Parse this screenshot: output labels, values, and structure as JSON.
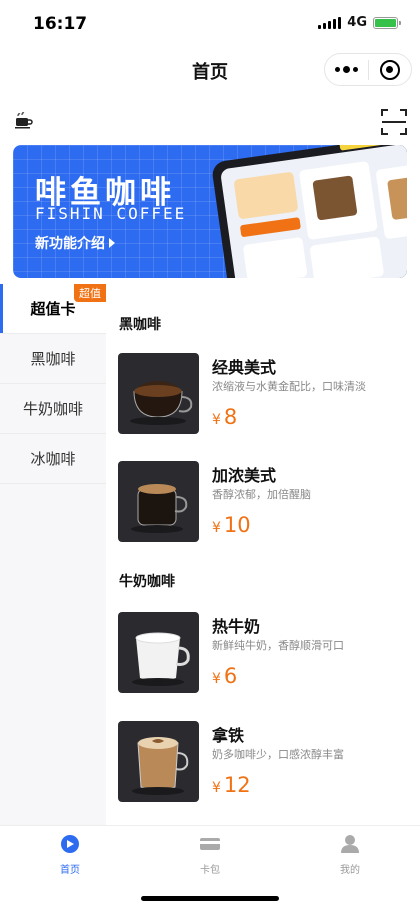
{
  "status": {
    "time": "16:17",
    "network": "4G"
  },
  "nav": {
    "title": "首页"
  },
  "banner": {
    "title_cn": "啡鱼咖啡",
    "title_en": "FISHIN COFFEE",
    "link": "新功能介绍"
  },
  "sidebar": {
    "items": [
      {
        "label": "超值卡",
        "badge": "超值"
      },
      {
        "label": "黑咖啡"
      },
      {
        "label": "牛奶咖啡"
      },
      {
        "label": "冰咖啡"
      }
    ]
  },
  "sections": [
    {
      "title": "黑咖啡",
      "products": [
        {
          "name": "经典美式",
          "desc": "浓缩液与水黄金配比，口味清淡",
          "currency": "¥",
          "price": "8"
        },
        {
          "name": "加浓美式",
          "desc": "香醇浓郁，加倍醒脑",
          "currency": "¥",
          "price": "10"
        }
      ]
    },
    {
      "title": "牛奶咖啡",
      "products": [
        {
          "name": "热牛奶",
          "desc": "新鲜纯牛奶，香醇顺滑可口",
          "currency": "¥",
          "price": "6"
        },
        {
          "name": "拿铁",
          "desc": "奶多咖啡少，口感浓醇丰富",
          "currency": "¥",
          "price": "12"
        }
      ]
    }
  ],
  "tabbar": {
    "items": [
      {
        "label": "首页"
      },
      {
        "label": "卡包"
      },
      {
        "label": "我的"
      }
    ]
  },
  "colors": {
    "accent": "#2d6bf0",
    "price": "#f07214",
    "badge": "#f07214",
    "battery": "#36c24a"
  }
}
